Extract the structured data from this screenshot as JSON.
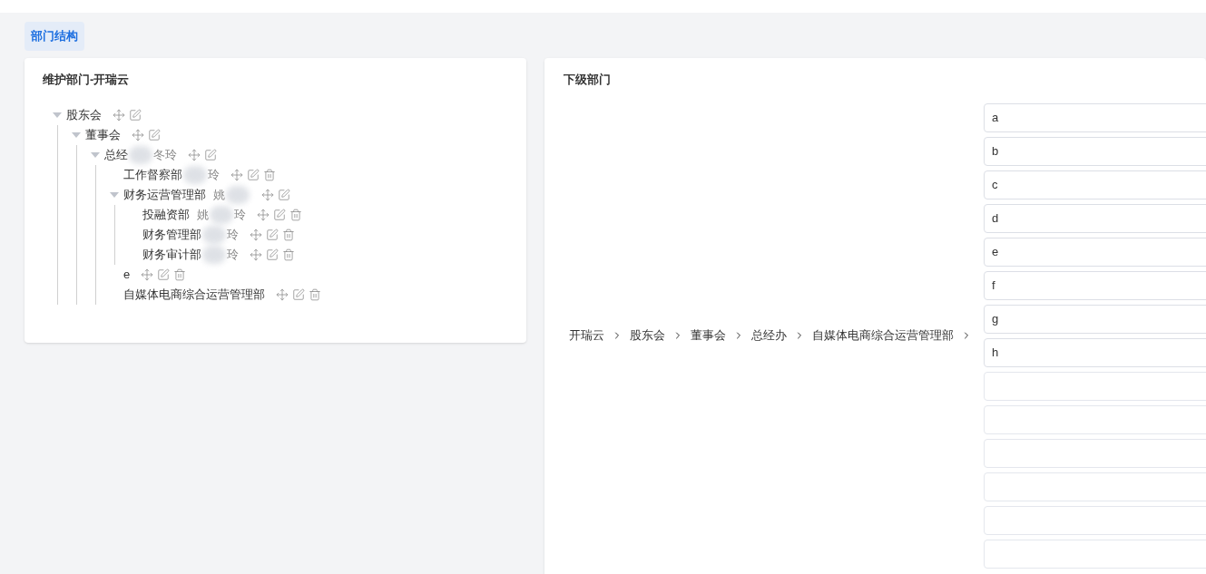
{
  "tabs": [
    {
      "label": "部门结构",
      "selected": true
    }
  ],
  "tree_panel": {
    "title": "维护部门-开瑞云",
    "nodes": [
      {
        "name": "股东会",
        "expanded": true,
        "deletable": false,
        "children": [
          {
            "name": "董事会",
            "expanded": true,
            "deletable": false,
            "children": [
              {
                "name": "总经",
                "manager_after": "冬玲",
                "expanded": true,
                "deletable": false,
                "children": [
                  {
                    "name": "工作督察部",
                    "manager_after": "玲",
                    "deletable": true
                  },
                  {
                    "name": "财务运营管理部",
                    "manager_before": "姚",
                    "expanded": true,
                    "deletable": false,
                    "children": [
                      {
                        "name": "投融资部",
                        "manager_before": "姚",
                        "manager_after": "玲",
                        "deletable": true
                      },
                      {
                        "name": "财务管理部",
                        "manager_after": "玲",
                        "deletable": true
                      },
                      {
                        "name": "财务审计部",
                        "manager_after": "玲",
                        "deletable": true
                      }
                    ]
                  },
                  {
                    "name": "e",
                    "deletable": true
                  },
                  {
                    "name": "自媒体电商综合运营管理部",
                    "deletable": true
                  }
                ]
              }
            ]
          }
        ]
      }
    ]
  },
  "sub_panel": {
    "title": "下级部门",
    "breadcrumb": [
      "开瑞云",
      "股东会",
      "董事会",
      "总经办",
      "自媒体电商综合运营管理部"
    ],
    "fields": [
      {
        "value": "a"
      },
      {
        "value": "b"
      },
      {
        "value": "c"
      },
      {
        "value": "d"
      },
      {
        "value": "e"
      },
      {
        "value": "f"
      },
      {
        "value": "g"
      },
      {
        "value": "h"
      },
      {
        "kind": "blank"
      },
      {
        "kind": "blank"
      },
      {
        "kind": "blank"
      },
      {
        "kind": "blank"
      },
      {
        "kind": "blank"
      },
      {
        "kind": "blank"
      }
    ]
  }
}
